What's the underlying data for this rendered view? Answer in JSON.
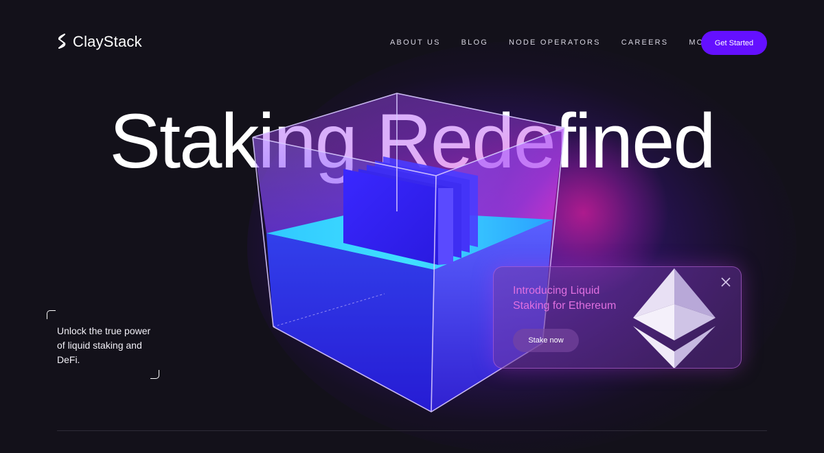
{
  "brand": {
    "name": "ClayStack",
    "icon": "claystack-logo-icon"
  },
  "nav": {
    "items": [
      {
        "label": "ABOUT US"
      },
      {
        "label": "BLOG"
      },
      {
        "label": "NODE OPERATORS"
      },
      {
        "label": "CAREERS"
      },
      {
        "label": "MORE"
      }
    ],
    "cta_label": "Get Started"
  },
  "hero": {
    "headline": "Staking Redefined",
    "tagline": "Unlock the true power of liquid staking and DeFi."
  },
  "promo": {
    "title": "Introducing Liquid Staking for Ethereum",
    "button_label": "Stake now",
    "icon": "ethereum-icon",
    "close_icon": "close-icon"
  },
  "colors": {
    "background": "#13111a",
    "accent": "#6410ff",
    "promo_title": "#e070e0"
  }
}
